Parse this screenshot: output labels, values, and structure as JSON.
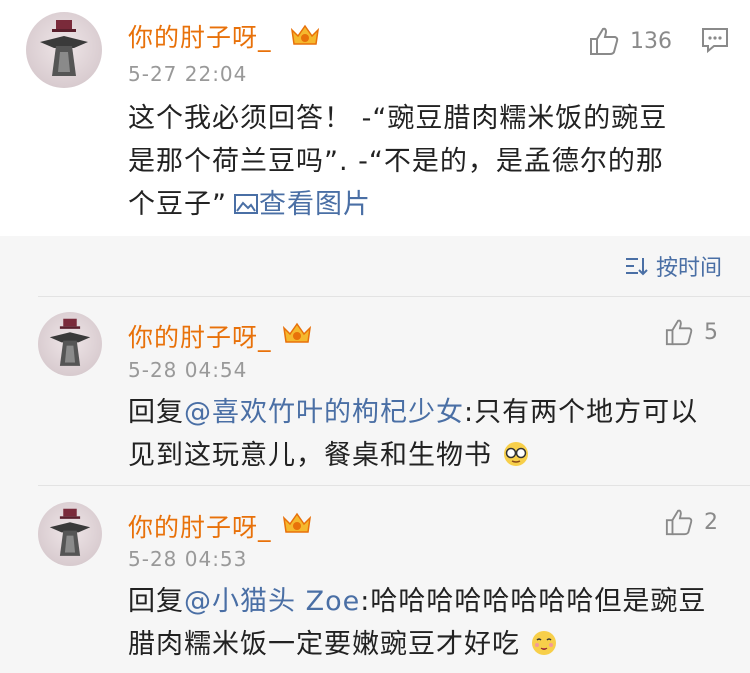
{
  "main_comment": {
    "username": "你的肘子呀_",
    "time": "5-27 22:04",
    "likes": "136",
    "text_line1": "这个我必须回答！ -“豌豆腊肉糯米饭的豌豆",
    "text_line2": "是那个荷兰豆吗”. -“不是的，是孟德尔的那",
    "text_line3": "个豆子”",
    "view_image": "查看图片"
  },
  "sort": {
    "label": "按时间"
  },
  "replies": [
    {
      "username": "你的肘子呀_",
      "time": "5-28 04:54",
      "likes": "5",
      "prefix": "回复",
      "mention": "@喜欢竹叶的枸杞少女",
      "text_line1": ":只有两个地方可以",
      "text_line2": "见到这玩意儿，餐桌和生物书"
    },
    {
      "username": "你的肘子呀_",
      "time": "5-28 04:53",
      "likes": "2",
      "prefix": "回复",
      "mention": "@小猫头 Zoe",
      "text_line1": ":哈哈哈哈哈哈哈哈但是豌豆",
      "text_line2": "腊肉糯米饭一定要嫩豌豆才好吃"
    }
  ],
  "colors": {
    "username": "#e8710a",
    "link": "#4a6fa5",
    "meta": "#999999",
    "reply_bg": "#f6f6f6"
  }
}
